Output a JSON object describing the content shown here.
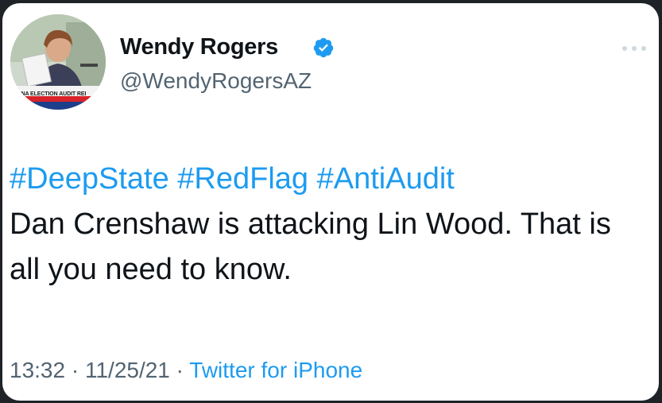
{
  "author": {
    "display_name": "Wendy Rogers",
    "handle": "@WendyRogersAZ",
    "verified": true,
    "avatar_caption": "ZONA ELECTION AUDIT REI"
  },
  "tweet": {
    "hashtags": [
      "#DeepState",
      "#RedFlag",
      "#AntiAudit"
    ],
    "text": "Dan Crenshaw is attacking Lin Wood. That is all you need to know."
  },
  "meta": {
    "time": "13:32",
    "separator": "·",
    "date": "11/25/21",
    "source": "Twitter for iPhone"
  },
  "colors": {
    "link_blue": "#1d9bf0",
    "text": "#0f1419",
    "muted": "#536471",
    "frame": "#1f2328"
  },
  "icons": {
    "verified": "verified-badge-icon",
    "more": "more-options-icon"
  }
}
